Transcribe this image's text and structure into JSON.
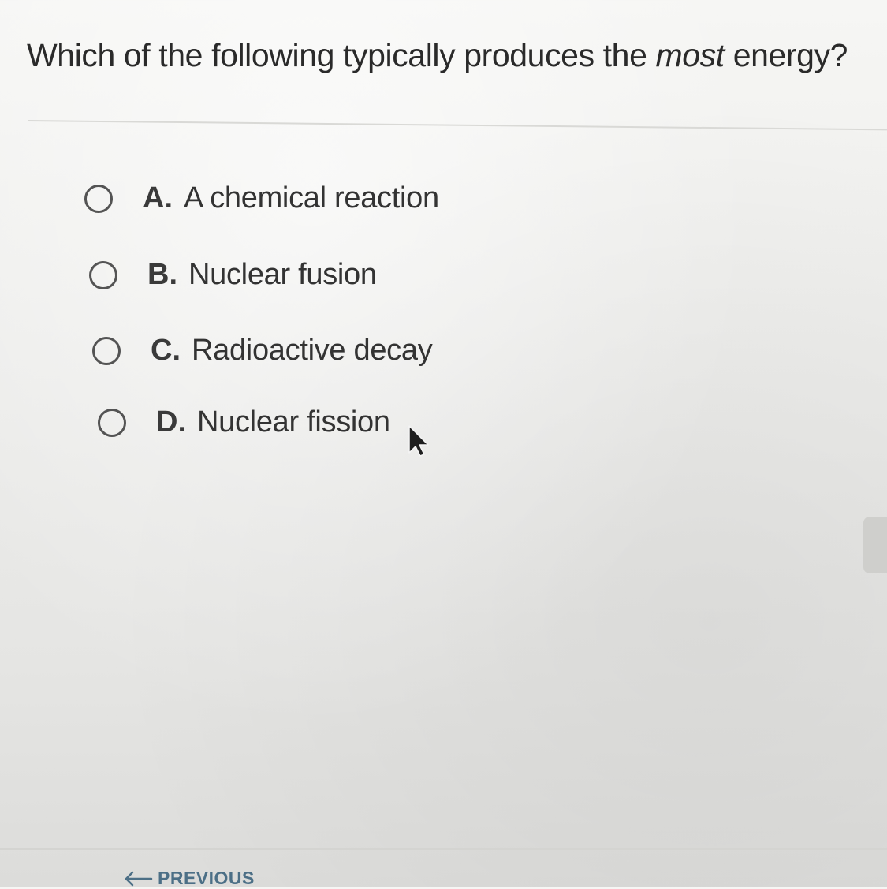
{
  "question": {
    "before": "Which of the following typically produces the ",
    "emphasis": "most",
    "after": " energy?"
  },
  "options": [
    {
      "letter": "A.",
      "text": "A chemical reaction"
    },
    {
      "letter": "B.",
      "text": "Nuclear fusion"
    },
    {
      "letter": "C.",
      "text": "Radioactive decay"
    },
    {
      "letter": "D.",
      "text": "Nuclear fission"
    }
  ],
  "navigation": {
    "previous_label": "PREVIOUS",
    "previous_icon": "arrow-left-icon"
  },
  "colors": {
    "text": "#2a2a2a",
    "radio_border": "#545454",
    "nav_link": "#4c6f86"
  }
}
